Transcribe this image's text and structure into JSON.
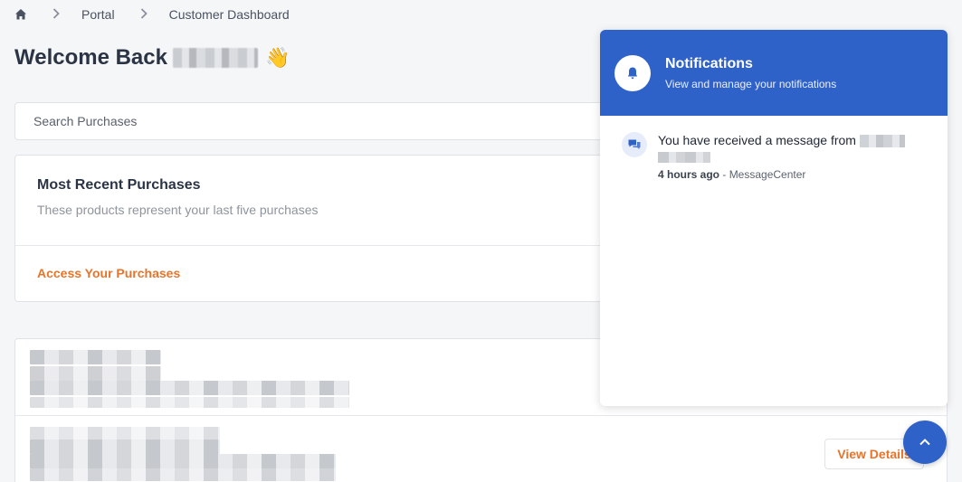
{
  "breadcrumb": {
    "home_icon": "home-icon",
    "items": [
      "Portal",
      "Customer Dashboard"
    ]
  },
  "page": {
    "title": "Welcome Back",
    "wave_emoji": "👋"
  },
  "search": {
    "placeholder": "Search Purchases"
  },
  "recent_purchases": {
    "title": "Most Recent Purchases",
    "subtitle": "These products represent your last five purchases",
    "link_label": "Access Your Purchases"
  },
  "purchase_list": {
    "view_details_label": "View Details"
  },
  "notifications": {
    "title": "Notifications",
    "subtitle": "View and manage your notifications",
    "items": [
      {
        "text": "You have received a message from",
        "time": "4 hours ago",
        "source": "- MessageCenter"
      }
    ]
  },
  "colors": {
    "accent": "#2f62c8",
    "link": "#e8742b"
  }
}
